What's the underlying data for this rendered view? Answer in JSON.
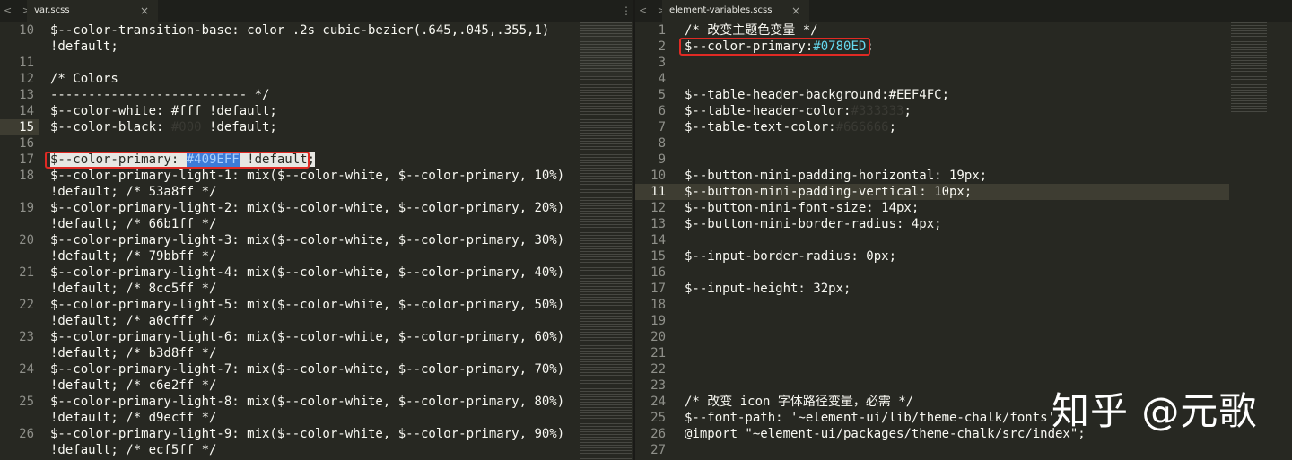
{
  "left": {
    "tab_label": "var.scss",
    "lines": [
      {
        "n": "10",
        "t": "$--color-transition-base: color .2s cubic-bezier(.645,.045,.355,1)"
      },
      {
        "n": "",
        "t": "!default;"
      },
      {
        "n": "11",
        "t": ""
      },
      {
        "n": "12",
        "t": "/* Colors"
      },
      {
        "n": "13",
        "t": "-------------------------- */"
      },
      {
        "n": "14",
        "t": "$--color-white: #fff !default;"
      },
      {
        "n": "15",
        "t": "$--color-black: #000 !default;"
      },
      {
        "n": "16",
        "t": ""
      },
      {
        "n": "17",
        "t": "$--color-primary: #409EFF !default;"
      },
      {
        "n": "18",
        "t": "$--color-primary-light-1: mix($--color-white, $--color-primary, 10%)"
      },
      {
        "n": "",
        "t": "!default; /* 53a8ff */"
      },
      {
        "n": "19",
        "t": "$--color-primary-light-2: mix($--color-white, $--color-primary, 20%)"
      },
      {
        "n": "",
        "t": "!default; /* 66b1ff */"
      },
      {
        "n": "20",
        "t": "$--color-primary-light-3: mix($--color-white, $--color-primary, 30%)"
      },
      {
        "n": "",
        "t": "!default; /* 79bbff */"
      },
      {
        "n": "21",
        "t": "$--color-primary-light-4: mix($--color-white, $--color-primary, 40%)"
      },
      {
        "n": "",
        "t": "!default; /* 8cc5ff */"
      },
      {
        "n": "22",
        "t": "$--color-primary-light-5: mix($--color-white, $--color-primary, 50%)"
      },
      {
        "n": "",
        "t": "!default; /* a0cfff */"
      },
      {
        "n": "23",
        "t": "$--color-primary-light-6: mix($--color-white, $--color-primary, 60%)"
      },
      {
        "n": "",
        "t": "!default; /* b3d8ff */"
      },
      {
        "n": "24",
        "t": "$--color-primary-light-7: mix($--color-white, $--color-primary, 70%)"
      },
      {
        "n": "",
        "t": "!default; /* c6e2ff */"
      },
      {
        "n": "25",
        "t": "$--color-primary-light-8: mix($--color-white, $--color-primary, 80%)"
      },
      {
        "n": "",
        "t": "!default; /* d9ecff */"
      },
      {
        "n": "26",
        "t": "$--color-primary-light-9: mix($--color-white, $--color-primary, 90%)"
      },
      {
        "n": "",
        "t": "!default; /* ecf5ff */"
      }
    ]
  },
  "right": {
    "tab_label": "element-variables.scss",
    "lines": [
      {
        "n": "1",
        "t": "/* 改变主题色变量 */"
      },
      {
        "n": "2",
        "t": "$--color-primary:#0780ED;"
      },
      {
        "n": "3",
        "t": ""
      },
      {
        "n": "4",
        "t": ""
      },
      {
        "n": "5",
        "t": "$--table-header-background:#EEF4FC;"
      },
      {
        "n": "6",
        "t": "$--table-header-color:#333333;"
      },
      {
        "n": "7",
        "t": "$--table-text-color:#666666;"
      },
      {
        "n": "8",
        "t": ""
      },
      {
        "n": "9",
        "t": ""
      },
      {
        "n": "10",
        "t": "$--button-mini-padding-horizontal: 19px;"
      },
      {
        "n": "11",
        "t": "$--button-mini-padding-vertical: 10px;"
      },
      {
        "n": "12",
        "t": "$--button-mini-font-size: 14px;"
      },
      {
        "n": "13",
        "t": "$--button-mini-border-radius: 4px;"
      },
      {
        "n": "14",
        "t": ""
      },
      {
        "n": "15",
        "t": "$--input-border-radius: 0px;"
      },
      {
        "n": "16",
        "t": ""
      },
      {
        "n": "17",
        "t": "$--input-height: 32px;"
      },
      {
        "n": "18",
        "t": ""
      },
      {
        "n": "19",
        "t": ""
      },
      {
        "n": "20",
        "t": ""
      },
      {
        "n": "21",
        "t": ""
      },
      {
        "n": "22",
        "t": ""
      },
      {
        "n": "23",
        "t": ""
      },
      {
        "n": "24",
        "t": "/* 改变 icon 字体路径变量，必需 */"
      },
      {
        "n": "25",
        "t": "$--font-path: '~element-ui/lib/theme-chalk/fonts';"
      },
      {
        "n": "26",
        "t": "@import \"~element-ui/packages/theme-chalk/src/index\";"
      },
      {
        "n": "27",
        "t": ""
      }
    ]
  },
  "ui": {
    "nav_arrows": "< >",
    "close_glyph": "×",
    "menu_glyph": "⋮",
    "watermark": "知乎 @元歌"
  },
  "colors": {
    "editor_bg": "#272822",
    "highlight_box": "#e02a24",
    "primary_hex_blue": "#66d9ef"
  }
}
